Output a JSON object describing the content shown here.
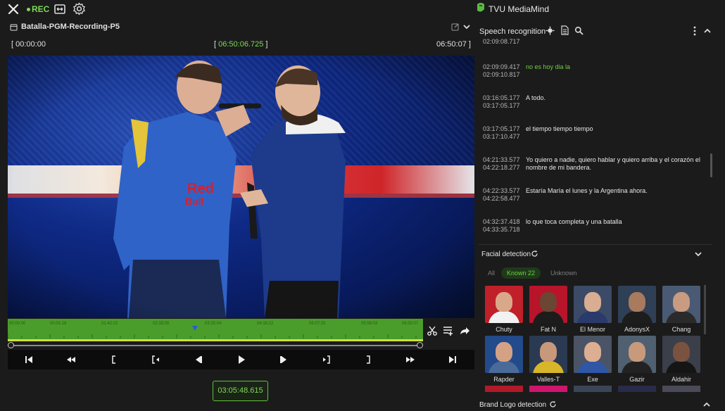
{
  "header": {
    "rec_label": "REC",
    "clip_title": "Batalla-PGM-Recording-P5"
  },
  "timecodes": {
    "start": "00:00:00",
    "current": "06:50:06.725",
    "end": "06:50:07",
    "playback": "03:05:48.615"
  },
  "timeline": {
    "tick_labels": [
      "00:00:00",
      "00:01:18",
      "01:42:22",
      "02:33:05",
      "03:25:04",
      "04:16:22",
      "05:07:20",
      "05:58:03",
      "06:50:07"
    ]
  },
  "right_panel": {
    "brand": "TVU MediaMind",
    "speech": {
      "title": "Speech recognition",
      "entries": [
        {
          "start": "",
          "end": "02:09:08.717",
          "text": ""
        },
        {
          "start": "02:09:09.417",
          "end": "02:09:10.817",
          "text": "no es hoy dia la",
          "active": true
        },
        {
          "start": "03:16:05.177",
          "end": "03:17:05.177",
          "text": "A todo."
        },
        {
          "start": "03:17:05.177",
          "end": "03:17:10.477",
          "text": "el tiempo tiempo tiempo"
        },
        {
          "start": "04:21:33.577",
          "end": "04:22:18.277",
          "text": "Yo quiero a nadie, quiero hablar y quiero arriba y el corazón el nombre de mi bandera."
        },
        {
          "start": "04:22:33.577",
          "end": "04:22:58.477",
          "text": "Estaría María el lunes y la Argentina ahora."
        },
        {
          "start": "04:32:37.418",
          "end": "04:33:35.718",
          "text": "lo que toca completa y una batalla"
        }
      ]
    },
    "facial": {
      "title": "Facial detection",
      "filters": {
        "all": "All",
        "known": "Known 22",
        "unknown": "Unknown"
      },
      "faces": [
        {
          "name": "Chuty",
          "bg": "#c0202a",
          "skin": "#d9a88a",
          "shirt": "#f2f2f2"
        },
        {
          "name": "Fat N",
          "bg": "#b8142a",
          "skin": "#6b4632",
          "shirt": "#1c1c1c"
        },
        {
          "name": "El Menor",
          "bg": "#3b4a66",
          "skin": "#d8ad92",
          "shirt": "#2a3b6b"
        },
        {
          "name": "AdonysX",
          "bg": "#2f3f55",
          "skin": "#a87a5e",
          "shirt": "#1d1d1d"
        },
        {
          "name": "Chang",
          "bg": "#4a5a74",
          "skin": "#c99b80",
          "shirt": "#2a2a2a"
        },
        {
          "name": "Rapder",
          "bg": "#234a8a",
          "skin": "#d4a185",
          "shirt": "#4a6a9a"
        },
        {
          "name": "Valles-T",
          "bg": "#2a3a52",
          "skin": "#c8987a",
          "shirt": "#d8b62a"
        },
        {
          "name": "Exe",
          "bg": "#4a5466",
          "skin": "#dcae92",
          "shirt": "#2f57a6"
        },
        {
          "name": "Gazir",
          "bg": "#506070",
          "skin": "#c89a7c",
          "shirt": "#222222"
        },
        {
          "name": "Aldahir",
          "bg": "#3a3f4a",
          "skin": "#7a5240",
          "shirt": "#151515"
        }
      ]
    },
    "brand_logo": {
      "title": "Brand Logo detection"
    }
  },
  "colors": {
    "accent": "#7ed957",
    "timeline": "#4a9d2a"
  }
}
